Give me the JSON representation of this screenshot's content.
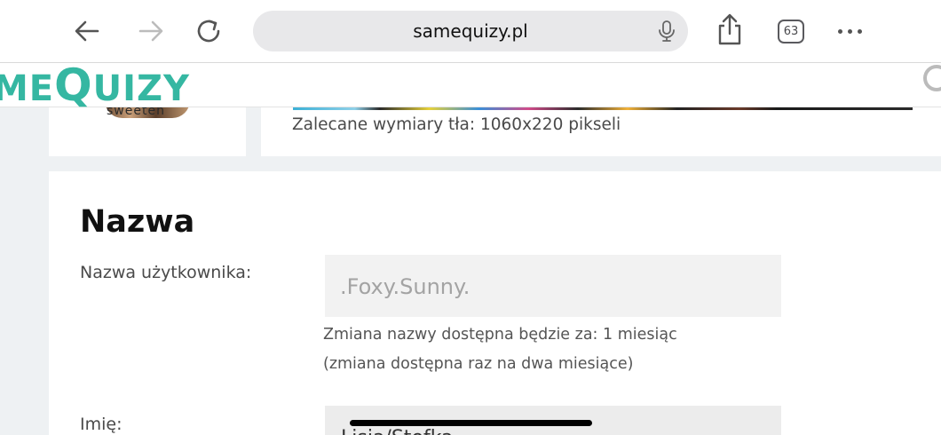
{
  "browser": {
    "url": "samequizy.pl",
    "tab_count": "63",
    "icons": {
      "back": "arrow-left-icon",
      "forward": "arrow-right-icon",
      "reload": "reload-icon",
      "mic": "microphone-icon",
      "share": "share-icon",
      "more": "more-dots-icon"
    }
  },
  "site": {
    "logo_left": "ME",
    "logo_q": "Q",
    "logo_right": "UIZY",
    "brand_color": "#35b7a2"
  },
  "profile": {
    "avatar_caption": "sweeten",
    "background_hint": "Zalecane wymiary tła: 1060x220 pikseli"
  },
  "name_section": {
    "title": "Nazwa",
    "username_label": "Nazwa użytkownika:",
    "username_placeholder": ".Foxy.Sunny.",
    "change_info": "Zmiana nazwy dostępna będzie za: 1 miesiąc",
    "change_rule": "(zmiana dostępna raz na dwa miesiące)",
    "first_name_label": "Imię:",
    "first_name_value": "Lisia/Stefka"
  }
}
